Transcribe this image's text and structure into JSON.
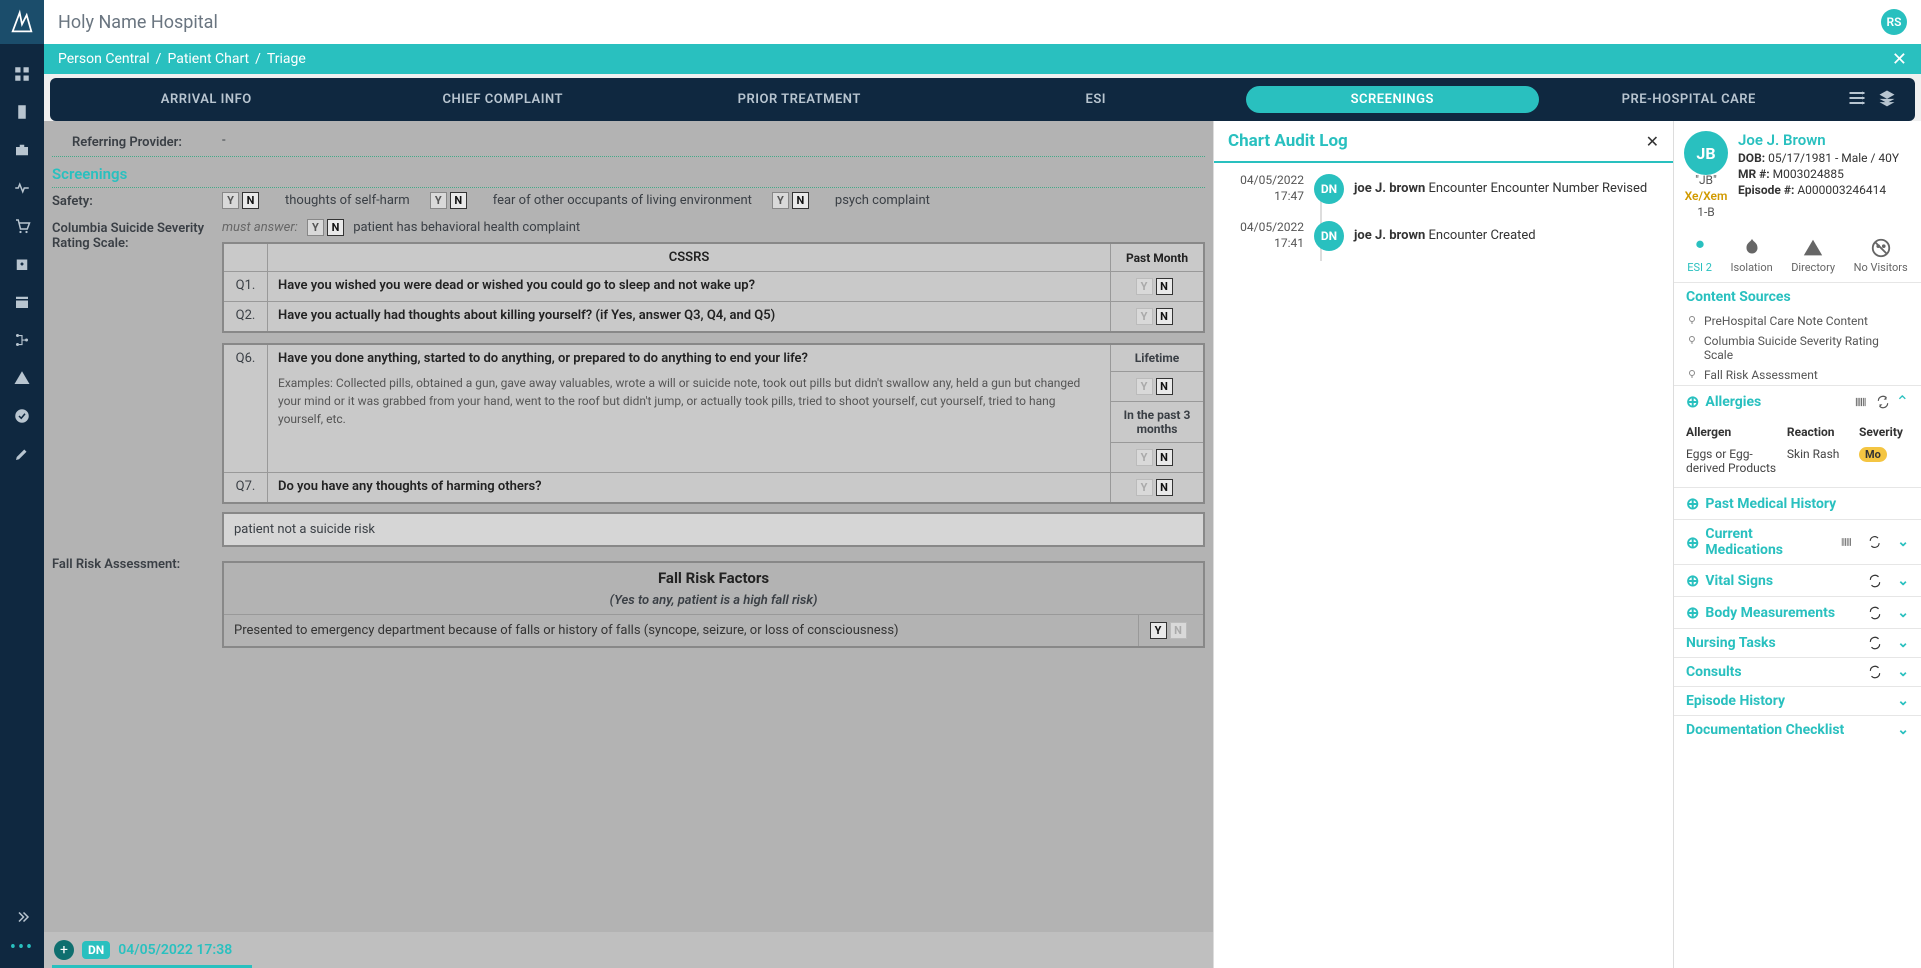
{
  "header": {
    "hospital": "Holy Name Hospital",
    "user_initials": "RS"
  },
  "breadcrumb": {
    "a": "Person Central",
    "b": "Patient Chart",
    "c": "Triage"
  },
  "tabs": [
    "ARRIVAL INFO",
    "CHIEF COMPLAINT",
    "PRIOR TREATMENT",
    "ESI",
    "SCREENINGS",
    "PRE-HOSPITAL CARE"
  ],
  "form": {
    "ref_provider_label": "Referring Provider:",
    "ref_provider_value": "-",
    "screenings_title": "Screenings",
    "safety_label": "Safety:",
    "safety_items": [
      "thoughts of self-harm",
      "fear of other occupants of living environment",
      "psych complaint"
    ],
    "cssrs_label": "Columbia Suicide Severity Rating Scale:",
    "must_answer": "must answer:",
    "must_answer_item": "patient has behavioral health complaint",
    "cssrs_title": "CSSRS",
    "past_month": "Past Month",
    "q1_num": "Q1.",
    "q1": "Have you wished you were dead or wished you could go to sleep and not wake up?",
    "q2_num": "Q2.",
    "q2": "Have you actually had thoughts about killing yourself? (if Yes, answer Q3, Q4, and Q5)",
    "q6_num": "Q6.",
    "q6": "Have you done anything, started to do anything, or prepared to do anything to end your life?",
    "q6_ex": "Examples: Collected pills, obtained a gun, gave away valuables, wrote a will or suicide note, took out pills but didn't swallow any, held a gun but changed your mind or it was grabbed from your hand, went to the roof but didn't jump, or actually took pills, tried to shoot yourself, cut yourself, tried to hang yourself, etc.",
    "lifetime": "Lifetime",
    "past3": "In the past 3 months",
    "q7_num": "Q7.",
    "q7": "Do you have any thoughts of harming others?",
    "note": "patient not a suicide risk",
    "fall_label": "Fall Risk Assessment:",
    "fall_title": "Fall Risk Factors",
    "fall_sub": "(Yes to any, patient is a high fall risk)",
    "fall_q1": "Presented to emergency department because of falls or history of falls (syncope, seizure, or loss of consciousness)"
  },
  "bottom": {
    "dn": "DN",
    "dt": "04/05/2022 17:38"
  },
  "audit": {
    "title": "Chart Audit Log",
    "items": [
      {
        "date": "04/05/2022",
        "time": "17:47",
        "who": "DN",
        "name": "joe J. brown",
        "msg": "Encounter Encounter Number Revised"
      },
      {
        "date": "04/05/2022",
        "time": "17:41",
        "who": "DN",
        "name": "joe J. brown",
        "msg": "Encounter Created"
      }
    ]
  },
  "patient": {
    "initials": "JB",
    "name": "Joe J. Brown",
    "dob_label": "DOB:",
    "dob": "05/17/1981 - Male / 40Y",
    "mr_label": "MR #:",
    "mr": "M003024885",
    "ep_label": "Episode #:",
    "ep": "A000003246414",
    "nick": "\"JB\"",
    "pronouns": "Xe/Xem",
    "room": "1-B",
    "badges": {
      "esi": "ESI 2",
      "iso": "Isolation",
      "dir": "Directory",
      "nov": "No Visitors"
    },
    "content_sources": "Content Sources",
    "sources": [
      "PreHospital Care Note Content",
      "Columbia Suicide Severity Rating Scale",
      "Fall Risk Assessment"
    ],
    "allergies": "Allergies",
    "allergy_head": {
      "a": "Allergen",
      "r": "Reaction",
      "s": "Severity"
    },
    "allergy_row": {
      "a": "Eggs or Egg-derived Products",
      "r": "Skin Rash",
      "s": "Mo"
    },
    "sections": {
      "pmh": "Past Medical History",
      "meds": "Current Medications",
      "vitals": "Vital Signs",
      "body": "Body Measurements",
      "nursing": "Nursing Tasks",
      "consults": "Consults",
      "episode": "Episode History",
      "doc": "Documentation Checklist"
    }
  }
}
